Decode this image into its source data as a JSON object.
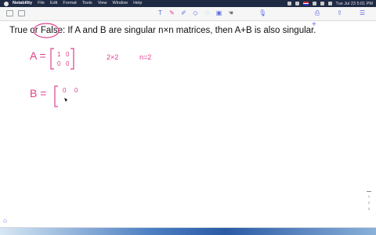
{
  "menubar": {
    "app_name": "Notability",
    "items": [
      "File",
      "Edit",
      "Format",
      "Tools",
      "View",
      "Window",
      "Help"
    ],
    "datetime": "Tue Jul 23  5:01 PM"
  },
  "toolbar": {
    "tools": [
      {
        "icon": "text-cursor-icon",
        "glyph": "T"
      },
      {
        "icon": "pen-icon",
        "glyph": "✎"
      },
      {
        "icon": "highlighter-icon",
        "glyph": "✐"
      },
      {
        "icon": "eraser-icon",
        "glyph": "◇"
      },
      {
        "icon": "lasso-icon",
        "glyph": "◌"
      },
      {
        "icon": "image-icon",
        "glyph": "▣"
      },
      {
        "icon": "hand-icon",
        "glyph": "☚"
      }
    ],
    "mic_glyph": "🎙",
    "right_icons": [
      "⎙",
      "⇪",
      "☰"
    ],
    "add_glyph": "+"
  },
  "note": {
    "question_pre": "True or ",
    "question_circled": "False:",
    "question_post": " If A and B are singular n×n matrices, then A+B is also singular.",
    "a_label": "A =",
    "a_matrix": [
      [
        "1",
        "0"
      ],
      [
        "0",
        "0"
      ]
    ],
    "size_note": "2×2",
    "n_note": "n=2",
    "b_label": "B =",
    "b_matrix_partial": [
      "0",
      "0"
    ],
    "ink_color": "#e0418f"
  },
  "pager": [
    "1",
    "2",
    "3"
  ]
}
